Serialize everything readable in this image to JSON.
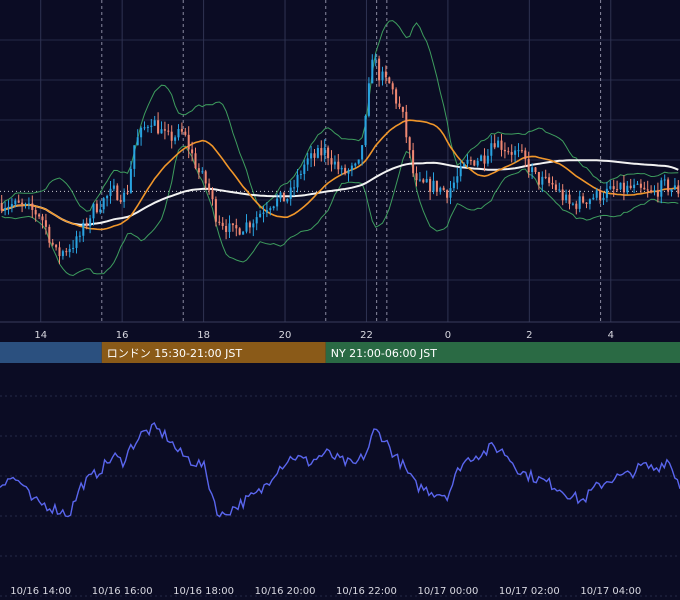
{
  "colors": {
    "background": "#0b0c24",
    "grid": "#262a48",
    "grid_vertical": "#2f3352",
    "divider": "#3a3d5c",
    "candle_up": "#29a3e0",
    "candle_down": "#f08872",
    "bollinger": "#3e9d5e",
    "ma_fast": "#f0962a",
    "ma_slow": "#f2f2f2",
    "price_line": "#c8c8d0",
    "oscillator": "#5a66ee",
    "session_tokyo": "#2b507f",
    "session_london": "#8a5a18",
    "session_ny": "#2a6a44"
  },
  "sessions": [
    {
      "label": ""
    },
    {
      "label": "ロンドン 15:30-21:00 JST"
    },
    {
      "label": "NY 21:00-06:00 JST"
    }
  ],
  "chart_data": [
    {
      "type": "candlestick",
      "panel": "price",
      "x_range_hours": [
        13.0,
        29.7
      ],
      "y_range": [
        0,
        100
      ],
      "x_tick_labels": [
        "14",
        "16",
        "18",
        "20",
        "22",
        "0",
        "2",
        "4"
      ],
      "x_ticks_hours": [
        14,
        16,
        18,
        20,
        22,
        24,
        26,
        28
      ],
      "session_boundaries_hours": [
        15.5,
        17.5,
        21.0,
        22.25,
        22.5,
        27.75
      ],
      "dotted_price_level": 42,
      "key_closes": [
        [
          13.0,
          38
        ],
        [
          13.5,
          37
        ],
        [
          14.0,
          34
        ],
        [
          14.4,
          20
        ],
        [
          14.9,
          25
        ],
        [
          15.3,
          36
        ],
        [
          15.8,
          42
        ],
        [
          16.1,
          40
        ],
        [
          16.3,
          58
        ],
        [
          16.7,
          67
        ],
        [
          17.1,
          60
        ],
        [
          17.5,
          62
        ],
        [
          17.9,
          48
        ],
        [
          18.1,
          44
        ],
        [
          18.3,
          34
        ],
        [
          18.7,
          28
        ],
        [
          19.2,
          32
        ],
        [
          19.6,
          38
        ],
        [
          20.1,
          40
        ],
        [
          20.5,
          52
        ],
        [
          21.0,
          56
        ],
        [
          21.4,
          48
        ],
        [
          21.8,
          50
        ],
        [
          22.0,
          68
        ],
        [
          22.15,
          90
        ],
        [
          22.3,
          82
        ],
        [
          22.6,
          78
        ],
        [
          22.9,
          67
        ],
        [
          23.2,
          44
        ],
        [
          23.6,
          44
        ],
        [
          24.0,
          42
        ],
        [
          24.5,
          52
        ],
        [
          24.9,
          54
        ],
        [
          25.1,
          60
        ],
        [
          25.4,
          57
        ],
        [
          25.8,
          54
        ],
        [
          26.2,
          46
        ],
        [
          26.6,
          44
        ],
        [
          27.0,
          37
        ],
        [
          27.5,
          40
        ],
        [
          28.0,
          42
        ],
        [
          28.5,
          43
        ],
        [
          29.0,
          41
        ],
        [
          29.3,
          44
        ],
        [
          29.7,
          42
        ]
      ]
    },
    {
      "type": "line",
      "panel": "oscillator",
      "x_tick_labels": [
        "10/16 14:00",
        "10/16 16:00",
        "10/16 18:00",
        "10/16 20:00",
        "10/16 22:00",
        "10/17 00:00",
        "10/17 02:00",
        "10/17 04:00"
      ],
      "x_ticks_hours": [
        14,
        16,
        18,
        20,
        22,
        24,
        26,
        28
      ],
      "y_range": [
        0,
        100
      ],
      "key_values": [
        [
          13.0,
          40
        ],
        [
          13.2,
          45
        ],
        [
          13.5,
          42
        ],
        [
          13.8,
          30
        ],
        [
          14.1,
          28
        ],
        [
          14.4,
          25
        ],
        [
          14.7,
          22
        ],
        [
          15.0,
          40
        ],
        [
          15.4,
          48
        ],
        [
          15.8,
          58
        ],
        [
          16.0,
          54
        ],
        [
          16.2,
          63
        ],
        [
          16.5,
          72
        ],
        [
          16.8,
          75
        ],
        [
          17.1,
          70
        ],
        [
          17.4,
          60
        ],
        [
          17.7,
          55
        ],
        [
          18.0,
          52
        ],
        [
          18.2,
          35
        ],
        [
          18.4,
          20
        ],
        [
          18.6,
          24
        ],
        [
          19.0,
          30
        ],
        [
          19.4,
          36
        ],
        [
          19.8,
          50
        ],
        [
          20.2,
          58
        ],
        [
          20.6,
          54
        ],
        [
          21.0,
          60
        ],
        [
          21.3,
          56
        ],
        [
          21.7,
          52
        ],
        [
          22.0,
          60
        ],
        [
          22.2,
          74
        ],
        [
          22.4,
          70
        ],
        [
          22.7,
          58
        ],
        [
          22.9,
          52
        ],
        [
          23.2,
          40
        ],
        [
          23.6,
          36
        ],
        [
          24.0,
          34
        ],
        [
          24.3,
          52
        ],
        [
          24.6,
          58
        ],
        [
          24.9,
          60
        ],
        [
          25.1,
          64
        ],
        [
          25.4,
          60
        ],
        [
          25.8,
          48
        ],
        [
          26.2,
          44
        ],
        [
          26.6,
          40
        ],
        [
          27.0,
          34
        ],
        [
          27.3,
          30
        ],
        [
          27.6,
          38
        ],
        [
          28.0,
          44
        ],
        [
          28.4,
          46
        ],
        [
          28.8,
          52
        ],
        [
          29.1,
          50
        ],
        [
          29.4,
          56
        ],
        [
          29.7,
          40
        ]
      ]
    }
  ]
}
